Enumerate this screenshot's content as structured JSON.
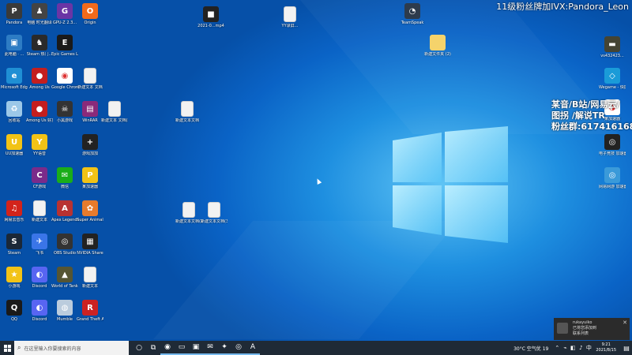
{
  "overlay": {
    "top_text": "11级粉丝牌加IVX:Pandora_Leon",
    "side_lines": [
      "某音/B站/网易云/",
      "图拐 /解说TR",
      "粉丝群:617416168"
    ]
  },
  "desktop_icons": [
    {
      "label": "Pandora",
      "color": "#3a3a3a",
      "glyph": "P"
    },
    {
      "label": "电脑 时光翻译",
      "color": "#444",
      "glyph": "♟"
    },
    {
      "label": "GPU-Z 2.3...",
      "color": "#6a35a5",
      "glyph": "G"
    },
    {
      "label": "Origin",
      "color": "#f26a1b",
      "glyph": "O"
    },
    {
      "label": "此电脑 · ...",
      "color": "#2d7cc4",
      "glyph": "▣"
    },
    {
      "label": "Steam 热门...",
      "color": "#2a2a2a",
      "glyph": "♞"
    },
    {
      "label": "Epic Games Launcher",
      "color": "#1a1a1a",
      "glyph": "E"
    },
    {
      "label": "Microsoft Edge",
      "color": "#1f8fd4",
      "glyph": "e"
    },
    {
      "label": "Among Us",
      "color": "#c41e1e",
      "glyph": "●"
    },
    {
      "label": "Google Chrome",
      "color": "#fff",
      "glyph": "◉"
    },
    {
      "label": "新建文本 文档",
      "color": "doc",
      "glyph": ""
    },
    {
      "label": "回收站",
      "color": "#9cc8e8",
      "glyph": "♻"
    },
    {
      "label": "Among Us 好友版",
      "color": "#c41e1e",
      "glyph": "●"
    },
    {
      "label": "小黑游戏",
      "color": "#333",
      "glyph": "☠"
    },
    {
      "label": "WinRAR",
      "color": "#8a2a7a",
      "glyph": "▤"
    },
    {
      "label": "新建文本 文档(2)",
      "color": "doc",
      "glyph": ""
    },
    {
      "label": "UU加速器",
      "color": "#f2c316",
      "glyph": "U"
    },
    {
      "label": "YY语音",
      "color": "#f2c316",
      "glyph": "Y"
    },
    {
      "label": "游戏加加",
      "color": "#222",
      "glyph": "+"
    },
    {
      "label": "CF游戏",
      "color": "#7a2b8a",
      "glyph": "C"
    },
    {
      "label": "微信",
      "color": "#1aad19",
      "glyph": "✉"
    },
    {
      "label": "某加速器",
      "color": "#f2c316",
      "glyph": "P"
    },
    {
      "label": "网易云音乐",
      "color": "#d2231b",
      "glyph": "♫"
    },
    {
      "label": "新建文本",
      "color": "doc",
      "glyph": ""
    },
    {
      "label": "Apex Legends",
      "color": "#b83232",
      "glyph": "A"
    },
    {
      "label": "Super Animal",
      "color": "#e77b2c",
      "glyph": "✿"
    },
    {
      "label": "Steam",
      "color": "#1b2838",
      "glyph": "S"
    },
    {
      "label": "飞书",
      "color": "#3a75e8",
      "glyph": "✈"
    },
    {
      "label": "OBS Studio",
      "color": "#333",
      "glyph": "◎"
    },
    {
      "label": "NVIDIA Share",
      "color": "#222",
      "glyph": "▦"
    },
    {
      "label": "小游戏",
      "color": "#f2c316",
      "glyph": "★"
    },
    {
      "label": "Discord",
      "color": "#5865f2",
      "glyph": "◐"
    },
    {
      "label": "World of Tanks",
      "color": "#553",
      "glyph": "▲"
    },
    {
      "label": "新建文本",
      "color": "doc",
      "glyph": ""
    },
    {
      "label": "QQ",
      "color": "#1a1a1a",
      "glyph": "Q"
    },
    {
      "label": "Discord",
      "color": "#5865f2",
      "glyph": "◐"
    },
    {
      "label": "Mumble",
      "color": "#bcd",
      "glyph": "◍"
    },
    {
      "label": "Grand Theft Auto",
      "color": "#c22",
      "glyph": "R"
    },
    {
      "label": "2021-0...mp4",
      "color": "#222",
      "glyph": "■"
    },
    {
      "label": "YY录屏...",
      "color": "doc",
      "glyph": ""
    },
    {
      "label": "TeamSpeak",
      "color": "#2d3b4c",
      "glyph": "◔"
    },
    {
      "label": "新建文件夹 (2)",
      "color": "folder",
      "glyph": ""
    },
    {
      "label": "新建文本文档",
      "color": "doc",
      "glyph": ""
    },
    {
      "label": "新建文本文档(2)",
      "color": "doc",
      "glyph": ""
    },
    {
      "label": "新建文本文档(3)",
      "color": "doc",
      "glyph": ""
    },
    {
      "label": "vs432423...",
      "color": "#443",
      "glyph": "▬"
    },
    {
      "label": "Wegame - 快捷方式",
      "color": "#1a9bd8",
      "glyph": "◇"
    },
    {
      "label": "某加速器",
      "color": "#fff",
      "glyph": "◑"
    },
    {
      "label": "电子竞技 加速器",
      "color": "#222",
      "glyph": "◎"
    },
    {
      "label": "网易网游 加速器",
      "color": "#3a9ad9",
      "glyph": "◎"
    }
  ],
  "toast": {
    "title": "rukayuiko",
    "line1": "已将您添加到",
    "line2": "联系列表",
    "close_glyph": "✕"
  },
  "taskbar": {
    "search_placeholder": "在这里输入你要搜索的内容",
    "weather": "30°C 空气优 19",
    "time": "9:21",
    "date": "2021/8/15",
    "apps": [
      {
        "name": "cortana",
        "glyph": "○"
      },
      {
        "name": "task-view",
        "glyph": "⧉"
      },
      {
        "name": "chrome",
        "glyph": "◉"
      },
      {
        "name": "explorer",
        "glyph": "▭"
      },
      {
        "name": "store",
        "glyph": "▣"
      },
      {
        "name": "mail",
        "glyph": "✉"
      },
      {
        "name": "twitter",
        "glyph": "✦"
      },
      {
        "name": "obs-app",
        "glyph": "◎"
      },
      {
        "name": "apex-app",
        "glyph": "A"
      }
    ],
    "tray_icons": [
      "⌃",
      "⌁",
      "◧",
      "♪",
      "中"
    ],
    "notify_glyph": "▤"
  }
}
